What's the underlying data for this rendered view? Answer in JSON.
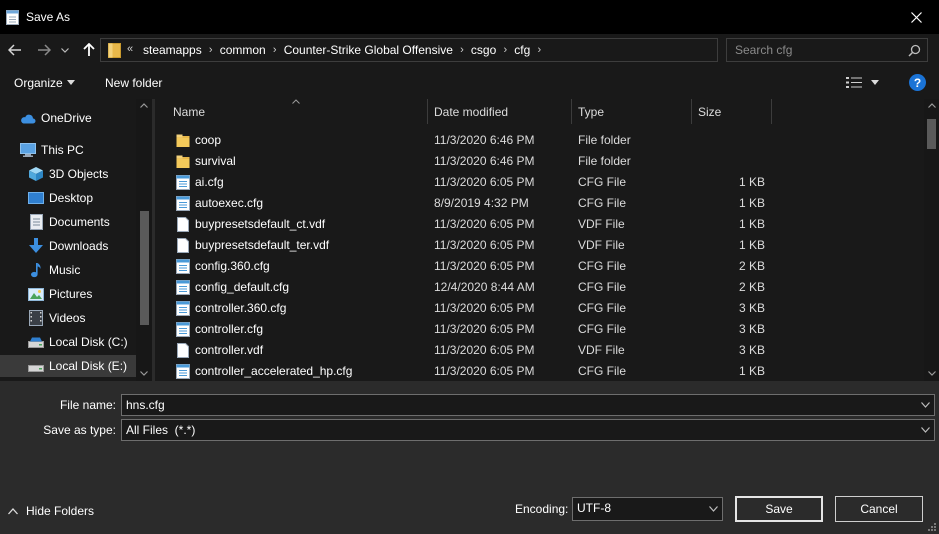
{
  "window": {
    "title": "Save As"
  },
  "address": {
    "overflow_chevron": "«",
    "crumbs": [
      "steamapps",
      "common",
      "Counter-Strike Global Offensive",
      "csgo",
      "cfg"
    ],
    "separator": "›"
  },
  "search": {
    "placeholder": "Search cfg"
  },
  "toolbar": {
    "organize_label": "Organize",
    "new_folder_label": "New folder",
    "help_label": "?"
  },
  "sidebar": {
    "items": [
      {
        "label": "OneDrive",
        "icon": "onedrive-cloud-icon"
      },
      {
        "label": "This PC",
        "icon": "computer-icon"
      },
      {
        "label": "3D Objects",
        "icon": "3d-objects-icon"
      },
      {
        "label": "Desktop",
        "icon": "desktop-icon"
      },
      {
        "label": "Documents",
        "icon": "documents-icon"
      },
      {
        "label": "Downloads",
        "icon": "downloads-icon"
      },
      {
        "label": "Music",
        "icon": "music-icon"
      },
      {
        "label": "Pictures",
        "icon": "pictures-icon"
      },
      {
        "label": "Videos",
        "icon": "videos-icon"
      },
      {
        "label": "Local Disk (C:)",
        "icon": "drive-icon"
      },
      {
        "label": "Local Disk (E:)",
        "icon": "drive-icon",
        "selected": true
      }
    ]
  },
  "columns": {
    "name": "Name",
    "date": "Date modified",
    "type": "Type",
    "size": "Size"
  },
  "files": [
    {
      "name": "coop",
      "date": "11/3/2020 6:46 PM",
      "type": "File folder",
      "size": "",
      "icon": "folder-icon"
    },
    {
      "name": "survival",
      "date": "11/3/2020 6:46 PM",
      "type": "File folder",
      "size": "",
      "icon": "folder-icon"
    },
    {
      "name": "ai.cfg",
      "date": "11/3/2020 6:05 PM",
      "type": "CFG File",
      "size": "1 KB",
      "icon": "notepad-file-icon"
    },
    {
      "name": "autoexec.cfg",
      "date": "8/9/2019 4:32 PM",
      "type": "CFG File",
      "size": "1 KB",
      "icon": "notepad-file-icon"
    },
    {
      "name": "buypresetsdefault_ct.vdf",
      "date": "11/3/2020 6:05 PM",
      "type": "VDF File",
      "size": "1 KB",
      "icon": "blank-file-icon"
    },
    {
      "name": "buypresetsdefault_ter.vdf",
      "date": "11/3/2020 6:05 PM",
      "type": "VDF File",
      "size": "1 KB",
      "icon": "blank-file-icon"
    },
    {
      "name": "config.360.cfg",
      "date": "11/3/2020 6:05 PM",
      "type": "CFG File",
      "size": "2 KB",
      "icon": "notepad-file-icon"
    },
    {
      "name": "config_default.cfg",
      "date": "12/4/2020 8:44 AM",
      "type": "CFG File",
      "size": "2 KB",
      "icon": "notepad-file-icon"
    },
    {
      "name": "controller.360.cfg",
      "date": "11/3/2020 6:05 PM",
      "type": "CFG File",
      "size": "3 KB",
      "icon": "notepad-file-icon"
    },
    {
      "name": "controller.cfg",
      "date": "11/3/2020 6:05 PM",
      "type": "CFG File",
      "size": "3 KB",
      "icon": "notepad-file-icon"
    },
    {
      "name": "controller.vdf",
      "date": "11/3/2020 6:05 PM",
      "type": "VDF File",
      "size": "3 KB",
      "icon": "blank-file-icon"
    },
    {
      "name": "controller_accelerated_hp.cfg",
      "date": "11/3/2020 6:05 PM",
      "type": "CFG File",
      "size": "1 KB",
      "icon": "notepad-file-icon"
    }
  ],
  "form": {
    "file_name_label": "File name:",
    "file_name_value": "hns.cfg",
    "save_as_type_label": "Save as type:",
    "save_as_type_value": "All Files  (*.*)",
    "encoding_label": "Encoding:",
    "encoding_value": "UTF-8"
  },
  "buttons": {
    "save": "Save",
    "cancel": "Cancel",
    "hide_folders": "Hide Folders"
  },
  "colors": {
    "help_blue": "#1a73d6",
    "folder_yellow": "#e8b84a",
    "onedrive_blue": "#3c8fe0",
    "file_icon_blue": "#4a9ad8"
  }
}
